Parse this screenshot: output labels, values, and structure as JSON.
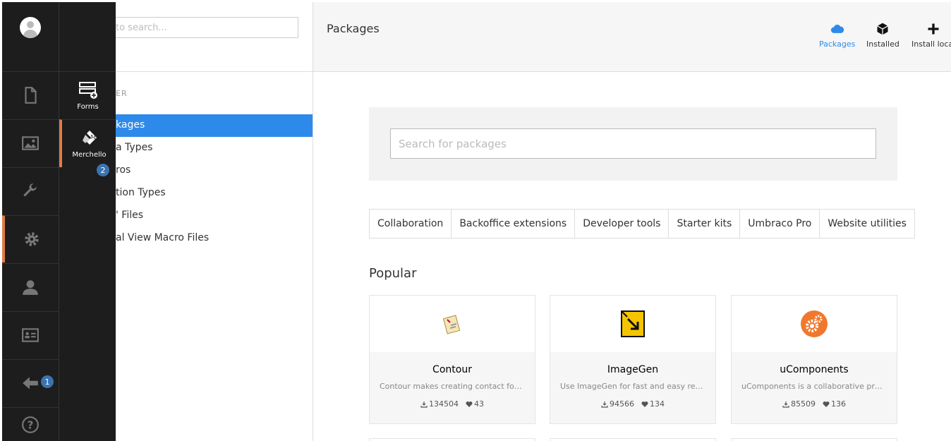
{
  "tree": {
    "search_placeholder": "to search...",
    "section_label": "ER",
    "items": [
      "kages",
      "a Types",
      "ros",
      "tion Types",
      "' Files",
      "al View Macro Files"
    ]
  },
  "flyout": {
    "items": [
      {
        "label": "Forms",
        "icon": "forms-icon"
      },
      {
        "label": "Merchello",
        "icon": "merchello-icon"
      }
    ]
  },
  "badges": {
    "merchello": "2",
    "back": "1"
  },
  "main": {
    "title": "Packages",
    "header_buttons": [
      {
        "label": "Packages",
        "icon": "cloud-icon"
      },
      {
        "label": "Installed",
        "icon": "box-icon"
      },
      {
        "label": "Install local",
        "icon": "plus-icon"
      }
    ],
    "search_placeholder": "Search for packages",
    "categories": [
      "Collaboration",
      "Backoffice extensions",
      "Developer tools",
      "Starter kits",
      "Umbraco Pro",
      "Website utilities"
    ],
    "popular_title": "Popular",
    "cards": [
      {
        "name": "Contour",
        "desc": "Contour makes creating contact forms...",
        "downloads": "134504",
        "likes": "43"
      },
      {
        "name": "ImageGen",
        "desc": "Use ImageGen for fast and easy resizing...",
        "downloads": "94566",
        "likes": "134"
      },
      {
        "name": "uComponents",
        "desc": "uComponents is a collaborative project...",
        "downloads": "85509",
        "likes": "136"
      }
    ]
  },
  "colors": {
    "accent": "#2e8aea",
    "active_marker": "#e07c45",
    "sidebar": "#1d1d1d",
    "badge": "#3a73b0"
  }
}
